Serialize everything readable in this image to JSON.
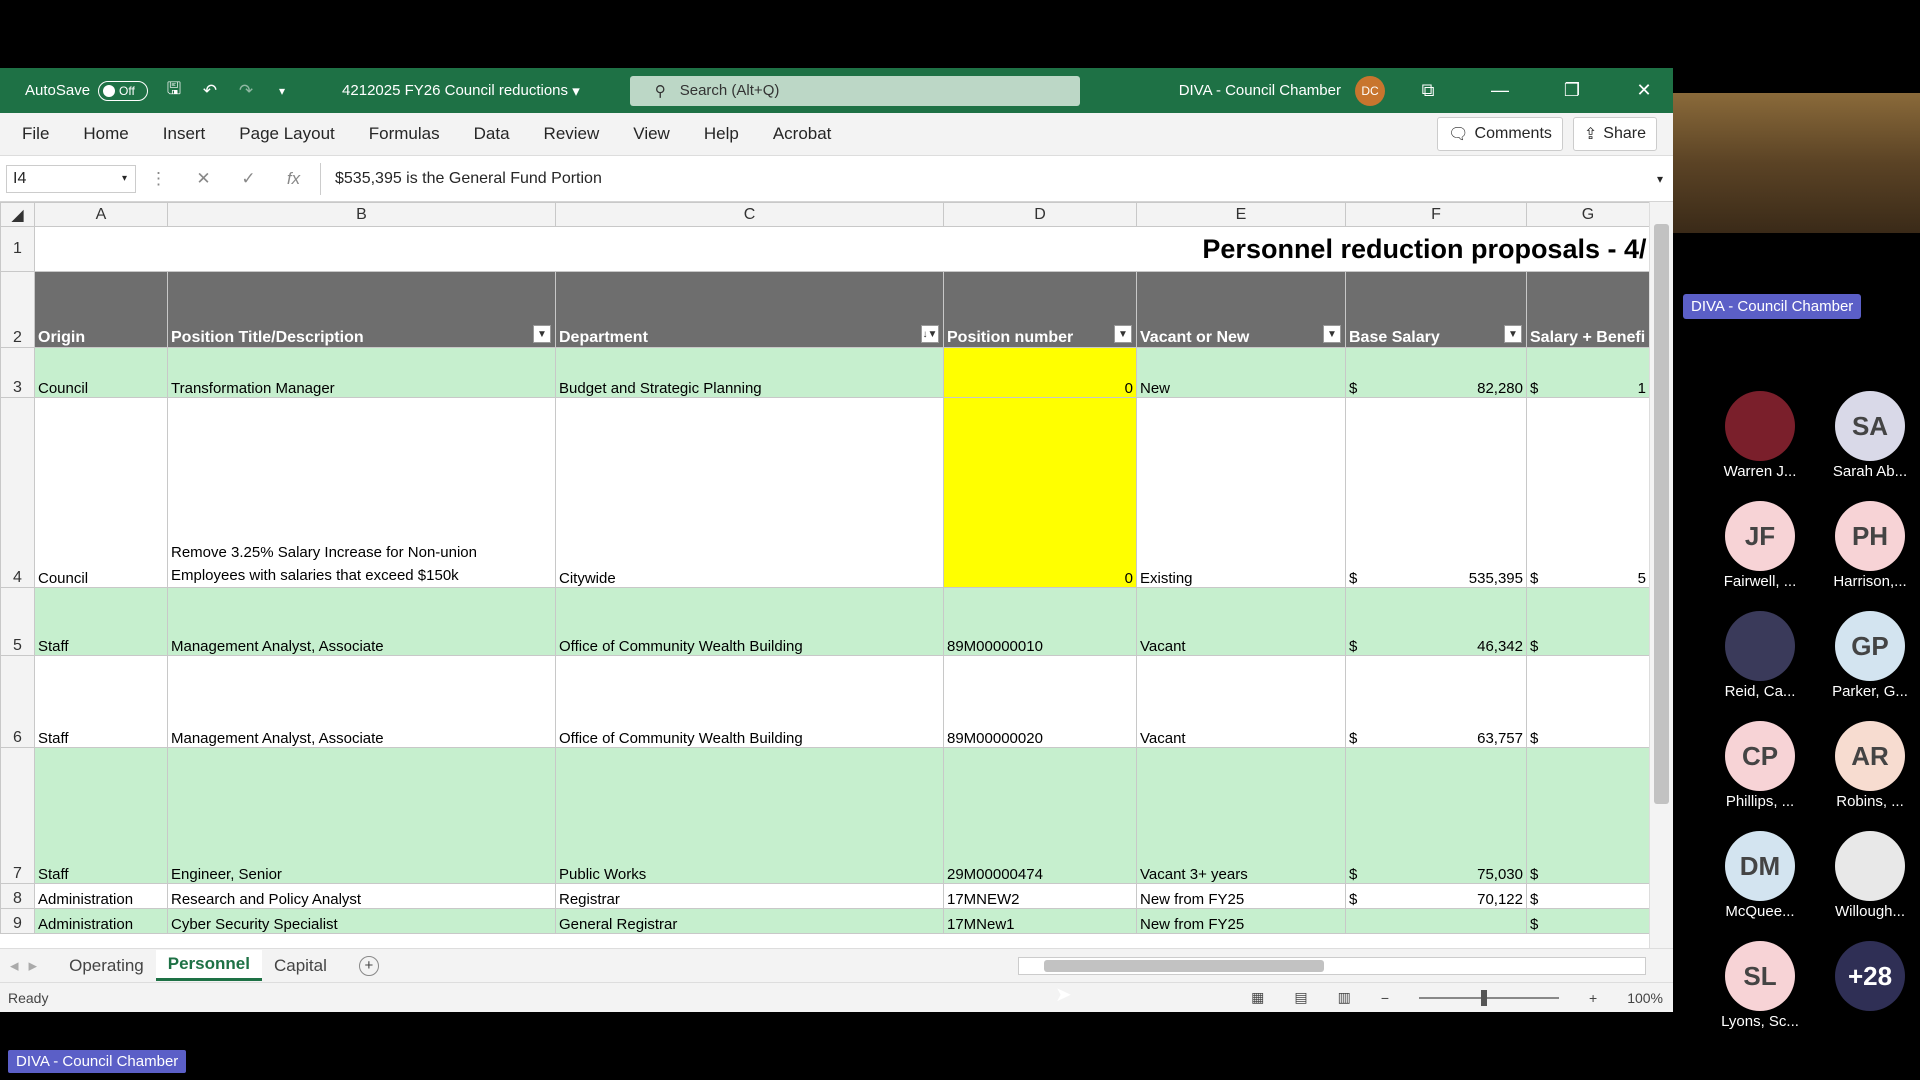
{
  "titlebar": {
    "autosave_label": "AutoSave",
    "autosave_state": "Off",
    "doc_title": "4212025 FY26 Council reductions",
    "search_placeholder": "Search (Alt+Q)",
    "account_name": "DIVA - Council Chamber",
    "account_initials": "DC"
  },
  "menu": {
    "items": [
      "File",
      "Home",
      "Insert",
      "Page Layout",
      "Formulas",
      "Data",
      "Review",
      "View",
      "Help",
      "Acrobat"
    ],
    "comments_label": "Comments",
    "share_label": "Share"
  },
  "formula_bar": {
    "cell_ref": "I4",
    "formula": "$535,395 is the General Fund Portion"
  },
  "columns": [
    "A",
    "B",
    "C",
    "D",
    "E",
    "F",
    "G"
  ],
  "sheet": {
    "title": "Personnel reduction proposals - 4/",
    "headers": [
      "Origin",
      "Position Title/Description",
      "Department",
      "Position number",
      "Vacant or New",
      "Base Salary",
      "Salary + Benefi"
    ],
    "rows": [
      {
        "num": "3",
        "origin": "Council",
        "title": "Transformation Manager",
        "dept": "Budget and Strategic Planning",
        "pos": "0",
        "status": "New",
        "cur": "$",
        "salary": "82,280",
        "g": "$",
        "gv": "1"
      },
      {
        "num": "4",
        "origin": "Council",
        "title": "Remove 3.25% Salary Increase for Non-union Employees with salaries that exceed $150k",
        "dept": "Citywide",
        "pos": "0",
        "status": "Existing",
        "cur": "$",
        "salary": "535,395",
        "g": "$",
        "gv": "5"
      },
      {
        "num": "5",
        "origin": "Staff",
        "title": "Management Analyst, Associate",
        "dept": "Office of Community Wealth Building",
        "pos": "89M00000010",
        "status": "Vacant",
        "cur": "$",
        "salary": "46,342",
        "g": "$",
        "gv": ""
      },
      {
        "num": "6",
        "origin": "Staff",
        "title": "Management Analyst, Associate",
        "dept": "Office of Community Wealth Building",
        "pos": "89M00000020",
        "status": "Vacant",
        "cur": "$",
        "salary": "63,757",
        "g": "$",
        "gv": ""
      },
      {
        "num": "7",
        "origin": "Staff",
        "title": "Engineer, Senior",
        "dept": "Public Works",
        "pos": "29M00000474",
        "status": "Vacant 3+ years",
        "cur": "$",
        "salary": "75,030",
        "g": "$",
        "gv": ""
      },
      {
        "num": "8",
        "origin": "Administration",
        "title": "Research and Policy Analyst",
        "dept": "Registrar",
        "pos": "17MNEW2",
        "status": "New from FY25",
        "cur": "$",
        "salary": "70,122",
        "g": "$",
        "gv": ""
      },
      {
        "num": "9",
        "origin": "Administration",
        "title": "Cyber Security Specialist",
        "dept": "General Registrar",
        "pos": "17MNew1",
        "status": "New from FY25",
        "cur": "",
        "salary": "",
        "g": "$",
        "gv": ""
      }
    ]
  },
  "tabs": [
    "Operating",
    "Personnel",
    "Capital"
  ],
  "status": {
    "ready": "Ready",
    "zoom": "100%"
  },
  "meeting": {
    "room": "DIVA - Council Chamber",
    "participants": [
      {
        "initials": "",
        "name": "Warren J...",
        "color": "#7a1f2b"
      },
      {
        "initials": "SA",
        "name": "Sarah Ab...",
        "color": "#d9d9e8"
      },
      {
        "initials": "JF",
        "name": "Fairwell, ...",
        "color": "#f7d3d6"
      },
      {
        "initials": "PH",
        "name": "Harrison,...",
        "color": "#f7d3d6"
      },
      {
        "initials": "",
        "name": "Reid, Ca...",
        "color": "#3a3a5a"
      },
      {
        "initials": "GP",
        "name": "Parker, G...",
        "color": "#d3e4f0"
      },
      {
        "initials": "CP",
        "name": "Phillips, ...",
        "color": "#f7d3d6"
      },
      {
        "initials": "AR",
        "name": "Robins, ...",
        "color": "#f7dcd0"
      },
      {
        "initials": "DM",
        "name": "McQuee...",
        "color": "#d3e4f0"
      },
      {
        "initials": "",
        "name": "Willough...",
        "color": "#e8e8e8"
      },
      {
        "initials": "SL",
        "name": "Lyons, Sc...",
        "color": "#f7d3d6"
      },
      {
        "initials": "+28",
        "name": "",
        "color": "#2f2f55"
      }
    ]
  }
}
